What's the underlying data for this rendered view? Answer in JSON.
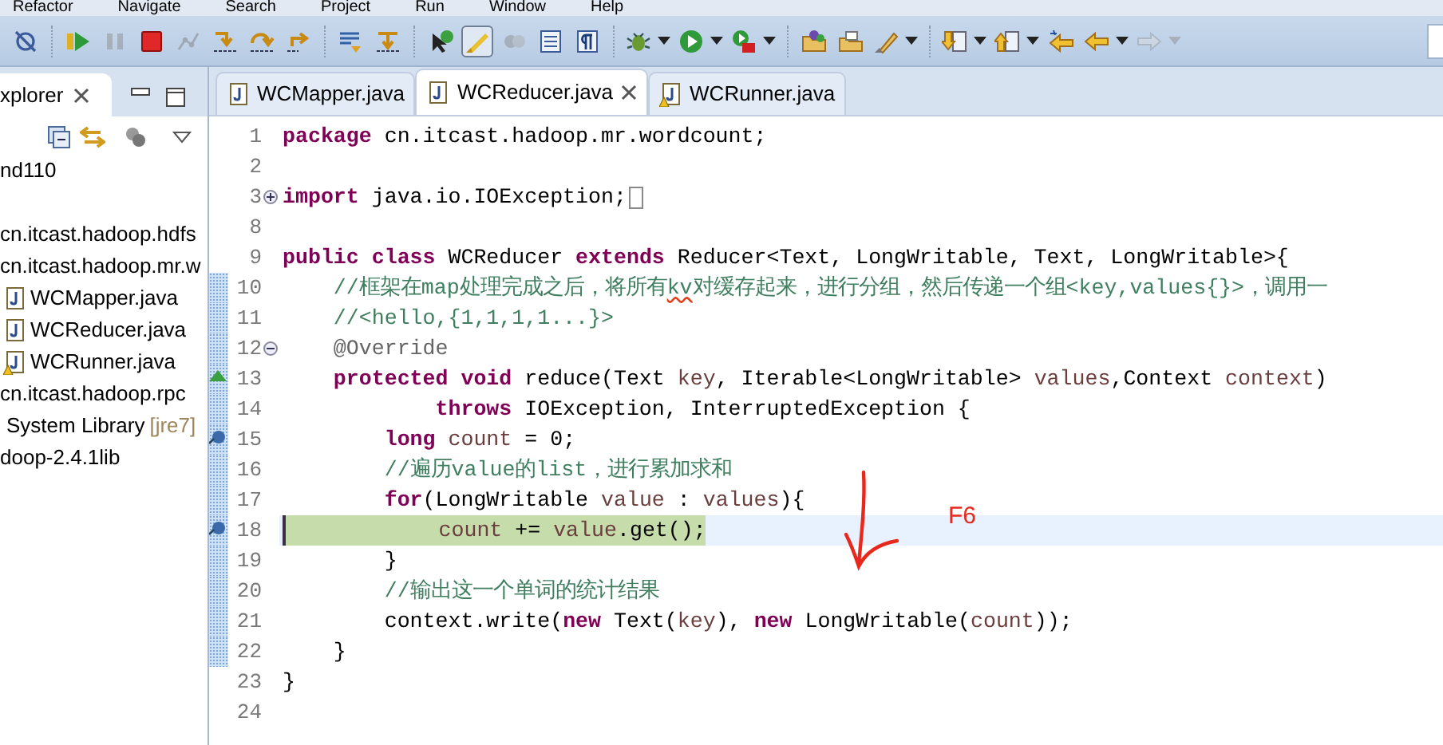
{
  "menu": [
    "Refactor",
    "Navigate",
    "Search",
    "Project",
    "Run",
    "Window",
    "Help"
  ],
  "toolbar": [
    [
      {
        "kind": "skip",
        "disabled": false,
        "pressed": false,
        "dropdown": false
      }
    ],
    [
      {
        "kind": "resume",
        "disabled": false,
        "pressed": false,
        "dropdown": false
      },
      {
        "kind": "suspend",
        "disabled": true,
        "pressed": false,
        "dropdown": false
      },
      {
        "kind": "terminate",
        "disabled": false,
        "pressed": false,
        "dropdown": false
      },
      {
        "kind": "disconnect",
        "disabled": true,
        "pressed": false,
        "dropdown": false
      },
      {
        "kind": "stepinto",
        "disabled": false,
        "pressed": false,
        "dropdown": false
      },
      {
        "kind": "stepover",
        "disabled": false,
        "pressed": false,
        "dropdown": false
      },
      {
        "kind": "stepreturn",
        "disabled": false,
        "pressed": false,
        "dropdown": false
      }
    ],
    [
      {
        "kind": "dropframe",
        "disabled": false,
        "pressed": false,
        "dropdown": false
      },
      {
        "kind": "filters",
        "disabled": false,
        "pressed": false,
        "dropdown": false
      }
    ],
    [
      {
        "kind": "tooltip",
        "disabled": false,
        "pressed": false,
        "dropdown": false
      },
      {
        "kind": "highlight",
        "disabled": false,
        "pressed": true,
        "dropdown": false
      },
      {
        "kind": "balls",
        "disabled": true,
        "pressed": false,
        "dropdown": false
      },
      {
        "kind": "block",
        "disabled": false,
        "pressed": false,
        "dropdown": false
      },
      {
        "kind": "pilcrow",
        "disabled": false,
        "pressed": false,
        "dropdown": false
      }
    ],
    [
      {
        "kind": "debug",
        "disabled": false,
        "pressed": false,
        "dropdown": true
      },
      {
        "kind": "run",
        "disabled": false,
        "pressed": false,
        "dropdown": true
      },
      {
        "kind": "external",
        "disabled": false,
        "pressed": false,
        "dropdown": true
      }
    ],
    [
      {
        "kind": "newproject",
        "disabled": false,
        "pressed": false,
        "dropdown": false
      },
      {
        "kind": "open",
        "disabled": false,
        "pressed": false,
        "dropdown": false
      },
      {
        "kind": "pen",
        "disabled": false,
        "pressed": false,
        "dropdown": true
      }
    ],
    [
      {
        "kind": "next",
        "disabled": false,
        "pressed": false,
        "dropdown": true
      },
      {
        "kind": "prev",
        "disabled": false,
        "pressed": false,
        "dropdown": true
      },
      {
        "kind": "lastedit",
        "disabled": false,
        "pressed": false,
        "dropdown": false
      },
      {
        "kind": "back",
        "disabled": false,
        "pressed": false,
        "dropdown": true
      },
      {
        "kind": "forward",
        "disabled": true,
        "pressed": false,
        "dropdown": true
      }
    ]
  ],
  "explorer": {
    "title": "xplorer",
    "tree": [
      {
        "label": "nd110",
        "kind": "project",
        "children": [
          {
            "label": "cn.itcast.hadoop.hdfs",
            "kind": "package"
          },
          {
            "label": "cn.itcast.hadoop.mr.w",
            "kind": "package",
            "children": [
              {
                "label": "WCMapper.java",
                "kind": "java",
                "warning": false
              },
              {
                "label": "WCReducer.java",
                "kind": "java",
                "warning": false
              },
              {
                "label": "WCRunner.java",
                "kind": "java",
                "warning": true
              }
            ]
          },
          {
            "label": "cn.itcast.hadoop.rpc",
            "kind": "package"
          },
          {
            "label": "System Library",
            "kind": "library",
            "decoration": "[jre7]"
          },
          {
            "label": "doop-2.4.1lib",
            "kind": "folder"
          }
        ]
      }
    ]
  },
  "editor": {
    "tabs": [
      {
        "label": "WCMapper.java",
        "selected": false,
        "warning": false
      },
      {
        "label": "WCReducer.java",
        "selected": true,
        "warning": false
      },
      {
        "label": "WCRunner.java",
        "selected": false,
        "warning": true
      }
    ],
    "lines": [
      {
        "number": "1",
        "changed": false,
        "current": false,
        "breakpoint": false,
        "override": false,
        "tokens": [
          {
            "kind": "keyword",
            "text": "package"
          },
          {
            "kind": "plain",
            "text": " cn.itcast.hadoop.mr.wordcount;"
          }
        ]
      },
      {
        "number": "2",
        "changed": false,
        "current": false,
        "breakpoint": false,
        "override": false
      },
      {
        "number": "3",
        "changed": false,
        "current": false,
        "breakpoint": false,
        "override": false,
        "folded": true,
        "tokens": [
          {
            "kind": "keyword",
            "text": "import"
          },
          {
            "kind": "plain",
            "text": " java.io.IOException;"
          }
        ]
      },
      {
        "number": "8",
        "changed": false,
        "current": false,
        "breakpoint": false,
        "override": false
      },
      {
        "number": "9",
        "changed": false,
        "current": false,
        "breakpoint": false,
        "override": false,
        "tokens": [
          {
            "kind": "keyword",
            "text": "public class"
          },
          {
            "kind": "plain",
            "text": " WCReducer "
          },
          {
            "kind": "keyword",
            "text": "extends"
          },
          {
            "kind": "plain",
            "text": " Reducer<Text, LongWritable, Text, LongWritable>{"
          }
        ]
      },
      {
        "number": "10",
        "changed": true,
        "current": false,
        "breakpoint": false,
        "override": false,
        "tokens": [
          {
            "kind": "comment",
            "text": "    //框架在map处理完成之后，将所有"
          },
          {
            "kind": "typo",
            "text": "kv"
          },
          {
            "kind": "comment",
            "text": "对缓存起来，进行分组，然后传递一个组<key,values{}>，调用一"
          }
        ]
      },
      {
        "number": "11",
        "changed": true,
        "current": false,
        "breakpoint": false,
        "override": false,
        "tokens": [
          {
            "kind": "comment",
            "text": "    //<hello,{1,1,1,1...}>"
          }
        ]
      },
      {
        "number": "12",
        "changed": true,
        "current": false,
        "breakpoint": false,
        "override": false,
        "folded": false,
        "tokens": [
          {
            "kind": "annotation",
            "text": "    @Override"
          }
        ]
      },
      {
        "number": "13",
        "changed": true,
        "current": false,
        "breakpoint": false,
        "override": true,
        "tokens": [
          {
            "kind": "keyword",
            "text": "    protected void"
          },
          {
            "kind": "plain",
            "text": " reduce(Text "
          },
          {
            "kind": "variable",
            "text": "key"
          },
          {
            "kind": "plain",
            "text": ", Iterable<LongWritable> "
          },
          {
            "kind": "variable",
            "text": "values"
          },
          {
            "kind": "plain",
            "text": ",Context "
          },
          {
            "kind": "variable",
            "text": "context"
          },
          {
            "kind": "plain",
            "text": ")"
          }
        ]
      },
      {
        "number": "14",
        "changed": true,
        "current": false,
        "breakpoint": false,
        "override": false,
        "tokens": [
          {
            "kind": "keyword",
            "text": "            throws"
          },
          {
            "kind": "plain",
            "text": " IOException, InterruptedException {"
          }
        ]
      },
      {
        "number": "15",
        "changed": true,
        "current": false,
        "breakpoint": true,
        "override": false,
        "tokens": [
          {
            "kind": "keyword",
            "text": "        long"
          },
          {
            "kind": "variable",
            "text": " count"
          },
          {
            "kind": "plain",
            "text": " = 0;"
          }
        ]
      },
      {
        "number": "16",
        "changed": true,
        "current": false,
        "breakpoint": false,
        "override": false,
        "tokens": [
          {
            "kind": "comment",
            "text": "        //遍历value的list，进行累加求和"
          }
        ]
      },
      {
        "number": "17",
        "changed": true,
        "current": false,
        "breakpoint": false,
        "override": false,
        "tokens": [
          {
            "kind": "keyword",
            "text": "        for"
          },
          {
            "kind": "plain",
            "text": "(LongWritable "
          },
          {
            "kind": "variable",
            "text": "value"
          },
          {
            "kind": "plain",
            "text": " : "
          },
          {
            "kind": "variable",
            "text": "values"
          },
          {
            "kind": "plain",
            "text": "){"
          }
        ]
      },
      {
        "number": "18",
        "changed": true,
        "current": true,
        "breakpoint": true,
        "override": false,
        "tokens": [
          {
            "kind": "variable",
            "text": "            count"
          },
          {
            "kind": "plain",
            "text": " += "
          },
          {
            "kind": "variable",
            "text": "value"
          },
          {
            "kind": "plain",
            "text": ".get();"
          }
        ]
      },
      {
        "number": "19",
        "changed": true,
        "current": false,
        "breakpoint": false,
        "override": false,
        "tokens": [
          {
            "kind": "plain",
            "text": "        }"
          }
        ]
      },
      {
        "number": "20",
        "changed": true,
        "current": false,
        "breakpoint": false,
        "override": false,
        "tokens": [
          {
            "kind": "comment",
            "text": "        //输出这一个单词的统计结果"
          }
        ]
      },
      {
        "number": "21",
        "changed": true,
        "current": false,
        "breakpoint": false,
        "override": false,
        "tokens": [
          {
            "kind": "plain",
            "text": "        context.write("
          },
          {
            "kind": "keyword",
            "text": "new"
          },
          {
            "kind": "plain",
            "text": " Text("
          },
          {
            "kind": "variable",
            "text": "key"
          },
          {
            "kind": "plain",
            "text": "), "
          },
          {
            "kind": "keyword",
            "text": "new"
          },
          {
            "kind": "plain",
            "text": " LongWritable("
          },
          {
            "kind": "variable",
            "text": "count"
          },
          {
            "kind": "plain",
            "text": "));"
          }
        ]
      },
      {
        "number": "22",
        "changed": true,
        "current": false,
        "breakpoint": false,
        "override": false,
        "tokens": [
          {
            "kind": "plain",
            "text": "    }"
          }
        ]
      },
      {
        "number": "23",
        "changed": false,
        "current": false,
        "breakpoint": false,
        "override": false,
        "tokens": [
          {
            "kind": "plain",
            "text": "}"
          }
        ]
      },
      {
        "number": "24",
        "changed": false,
        "current": false,
        "breakpoint": false,
        "override": false
      }
    ]
  },
  "annotation": {
    "label": "F6"
  }
}
